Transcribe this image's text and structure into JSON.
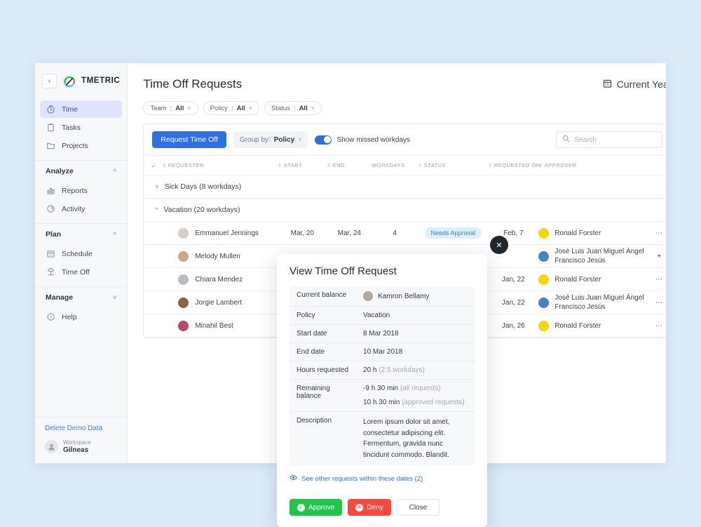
{
  "sidebar": {
    "collapse_icon": "chevron-left-icon",
    "brand": "TMETRIC",
    "nav": [
      {
        "label": "Time",
        "icon": "timer-icon",
        "active": true
      },
      {
        "label": "Tasks",
        "icon": "clipboard-icon",
        "active": false
      },
      {
        "label": "Projects",
        "icon": "folder-icon",
        "active": false
      }
    ],
    "groups": [
      {
        "title": "Analyze",
        "chevron": "chevron-up-icon",
        "items": [
          {
            "label": "Reports",
            "icon": "bar-chart-icon"
          },
          {
            "label": "Activity",
            "icon": "pie-chart-icon"
          }
        ]
      },
      {
        "title": "Plan",
        "chevron": "chevron-up-icon",
        "items": [
          {
            "label": "Schedule",
            "icon": "calendar-icon"
          },
          {
            "label": "Time Off",
            "icon": "beach-icon"
          }
        ]
      },
      {
        "title": "Manage",
        "chevron": "chevron-down-icon",
        "items": [
          {
            "label": "Help",
            "icon": "question-icon"
          }
        ]
      }
    ],
    "delete_demo": "Delete Demo Data",
    "workspace_label": "Workspace",
    "workspace_name": "Gilneas"
  },
  "header": {
    "title": "Time Off Requests",
    "year_icon": "calendar-icon",
    "year_label": "Current Year"
  },
  "filters": [
    {
      "name": "Team",
      "value": "All"
    },
    {
      "name": "Policy",
      "value": "All"
    },
    {
      "name": "Status",
      "value": "All"
    }
  ],
  "toolbar": {
    "request_button": "Request Time Off",
    "group_by_label": "Group by:",
    "group_by_value": "Policy",
    "toggle_label": "Show missed workdays",
    "toggle_on": true,
    "search_placeholder": "Search",
    "search_value": ""
  },
  "table": {
    "columns": [
      {
        "label": "REQUESTER",
        "sortable": true
      },
      {
        "label": "START",
        "sortable": true
      },
      {
        "label": "END",
        "sortable": true
      },
      {
        "label": "WORKDAYS",
        "sortable": false
      },
      {
        "label": "STATUS",
        "sortable": true
      },
      {
        "label": "REQUESTED ON",
        "sortable": true
      },
      {
        "label": "APPROVER",
        "sortable": true
      }
    ],
    "groups": [
      {
        "label": "Sick Days (8 workdays)",
        "expanded": false,
        "chevron": "chevron-down-icon"
      },
      {
        "label": "Vacation (20 workdays)",
        "expanded": true,
        "chevron": "chevron-up-icon"
      }
    ],
    "rows": [
      {
        "requester": "Emmanuel Jennings",
        "avatar_color": "#d7cfc8",
        "start": "Mar, 20",
        "end": "Mar, 24",
        "workdays": "4",
        "status": "Needs Approval",
        "requested_on": "Feb, 7",
        "approver": "Ronald Forster",
        "approver_avatar": "#ffd500",
        "action": "more-icon"
      },
      {
        "requester": "Melody Mullen",
        "avatar_color": "#c9a88d",
        "start": "",
        "end": "",
        "workdays": "",
        "status": "",
        "requested_on": "",
        "approver": "José Luis Juan Miguel Ángel Francisco Jesús",
        "approver_avatar": "#4a7fc1",
        "action": "plus-icon"
      },
      {
        "requester": "Chiara Mendez",
        "avatar_color": "#b9bcc2",
        "start": "",
        "end": "",
        "workdays": "",
        "status": "",
        "requested_on": "Jan, 22",
        "approver": "Ronald Forster",
        "approver_avatar": "#ffd500",
        "action": "more-icon"
      },
      {
        "requester": "Jorgie Lambert",
        "avatar_color": "#8f5f4a",
        "start": "",
        "end": "",
        "workdays": "",
        "status": "",
        "requested_on": "Jan, 22",
        "approver": "José Luis Juan Miguel Ángel Francisco Jesús",
        "approver_avatar": "#4a7fc1",
        "action": "more-icon"
      },
      {
        "requester": "Minahil Best",
        "avatar_color": "#c2436e",
        "start": "",
        "end": "",
        "workdays": "",
        "status": "",
        "requested_on": "Jan, 26",
        "approver": "Ronald Forster",
        "approver_avatar": "#ffd500",
        "action": "more-icon"
      }
    ]
  },
  "modal": {
    "title": "View Time Off Request",
    "close_icon": "close-icon",
    "rows": {
      "current_balance_key": "Current balance",
      "current_balance_value": "Kamron Bellamy",
      "policy_key": "Policy",
      "policy_value": "Vacation",
      "start_key": "Start date",
      "start_value": "8 Mar 2018",
      "end_key": "End date",
      "end_value": "10 Mar 2018",
      "hours_key": "Hours requested",
      "hours_value": "20 h",
      "hours_note": "(2.5 workdays)",
      "remaining_key": "Remaining balance",
      "remaining_all_value": "-9 h 30 min",
      "remaining_all_note": "(all requests)",
      "remaining_approved_value": "10 h 30 min",
      "remaining_approved_note": "(approved requests)",
      "description_key": "Description",
      "description_value": "Lorem ipsum dolor sit amet, consectetur adipiscing elit. Fermentum, gravida nunc tincidunt commodo. Blandit."
    },
    "see_other_icon": "eye-icon",
    "see_other_label": "See other requests within these dates (2)",
    "approve_label": "Approve",
    "deny_label": "Deny",
    "close_label": "Close"
  },
  "colors": {
    "page_background": "#dcebf8",
    "accent_blue": "#2f6fe4",
    "approve_green": "#1ec64a",
    "deny_red": "#f9483f",
    "badge_bg": "#ddeffb",
    "badge_text": "#3d7ea8"
  }
}
